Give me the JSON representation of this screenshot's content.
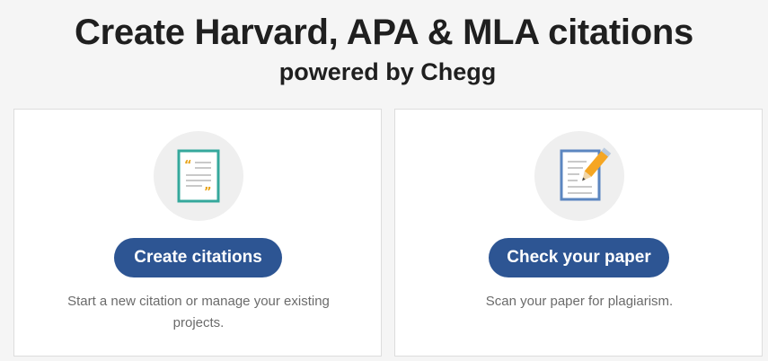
{
  "header": {
    "title": "Create Harvard, APA & MLA citations",
    "subtitle": "powered by Chegg"
  },
  "cards": [
    {
      "icon": "citation-document-icon",
      "button_label": "Create citations",
      "description": "Start a new citation or manage your existing projects."
    },
    {
      "icon": "paper-pencil-icon",
      "button_label": "Check your paper",
      "description": "Scan your paper for plagiarism."
    }
  ],
  "colors": {
    "button": "#2d5593",
    "background": "#f5f5f5",
    "card": "#ffffff",
    "citation_icon_border": "#35a89c",
    "citation_icon_quotes": "#e8a317",
    "paper_icon_border": "#5b86c0",
    "pencil": "#f5a623"
  }
}
